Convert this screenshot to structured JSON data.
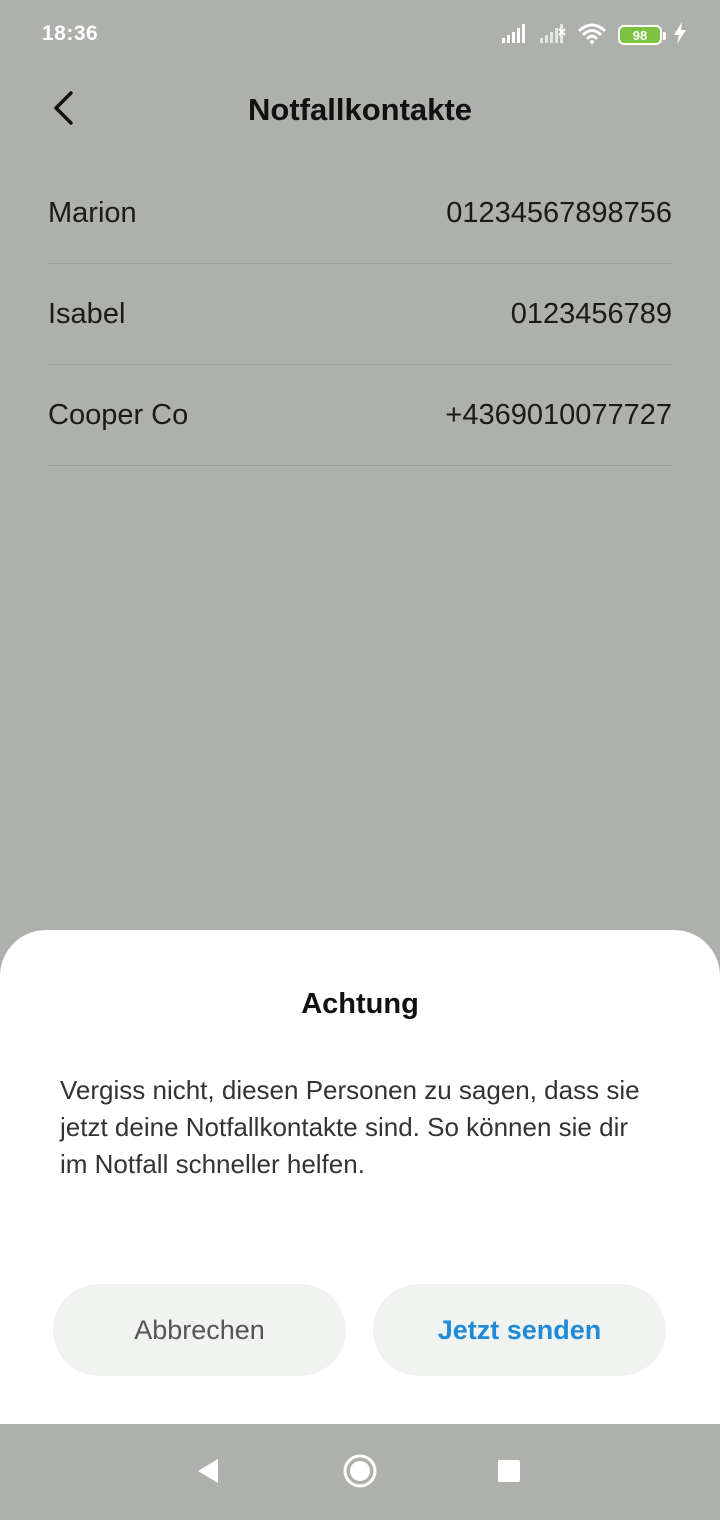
{
  "status_bar": {
    "time": "18:36",
    "battery": "98",
    "icons": [
      "signal-icon",
      "signal-icon-secondary",
      "wifi-icon",
      "battery-icon",
      "charging-icon"
    ]
  },
  "header": {
    "title": "Notfallkontakte",
    "back_icon": "chevron-left-icon"
  },
  "contacts": [
    {
      "name": "Marion",
      "phone": "01234567898756"
    },
    {
      "name": "Isabel",
      "phone": "0123456789"
    },
    {
      "name": "Cooper Co",
      "phone": "+4369010077727"
    }
  ],
  "dialog": {
    "title": "Achtung",
    "message": "Vergiss nicht, diesen Personen zu sagen, dass sie jetzt deine Notfallkontakte sind. So können sie dir im Notfall schneller helfen.",
    "cancel_label": "Abbrechen",
    "confirm_label": "Jetzt senden"
  },
  "nav_bar": {
    "icons": [
      "nav-back-icon",
      "nav-home-icon",
      "nav-recents-icon"
    ]
  },
  "colors": {
    "dimmed_background": "#adb0ab",
    "sheet_background": "#ffffff",
    "button_background": "#f1f3f1",
    "accent": "#1f8ad8",
    "battery": "#7cc243"
  }
}
